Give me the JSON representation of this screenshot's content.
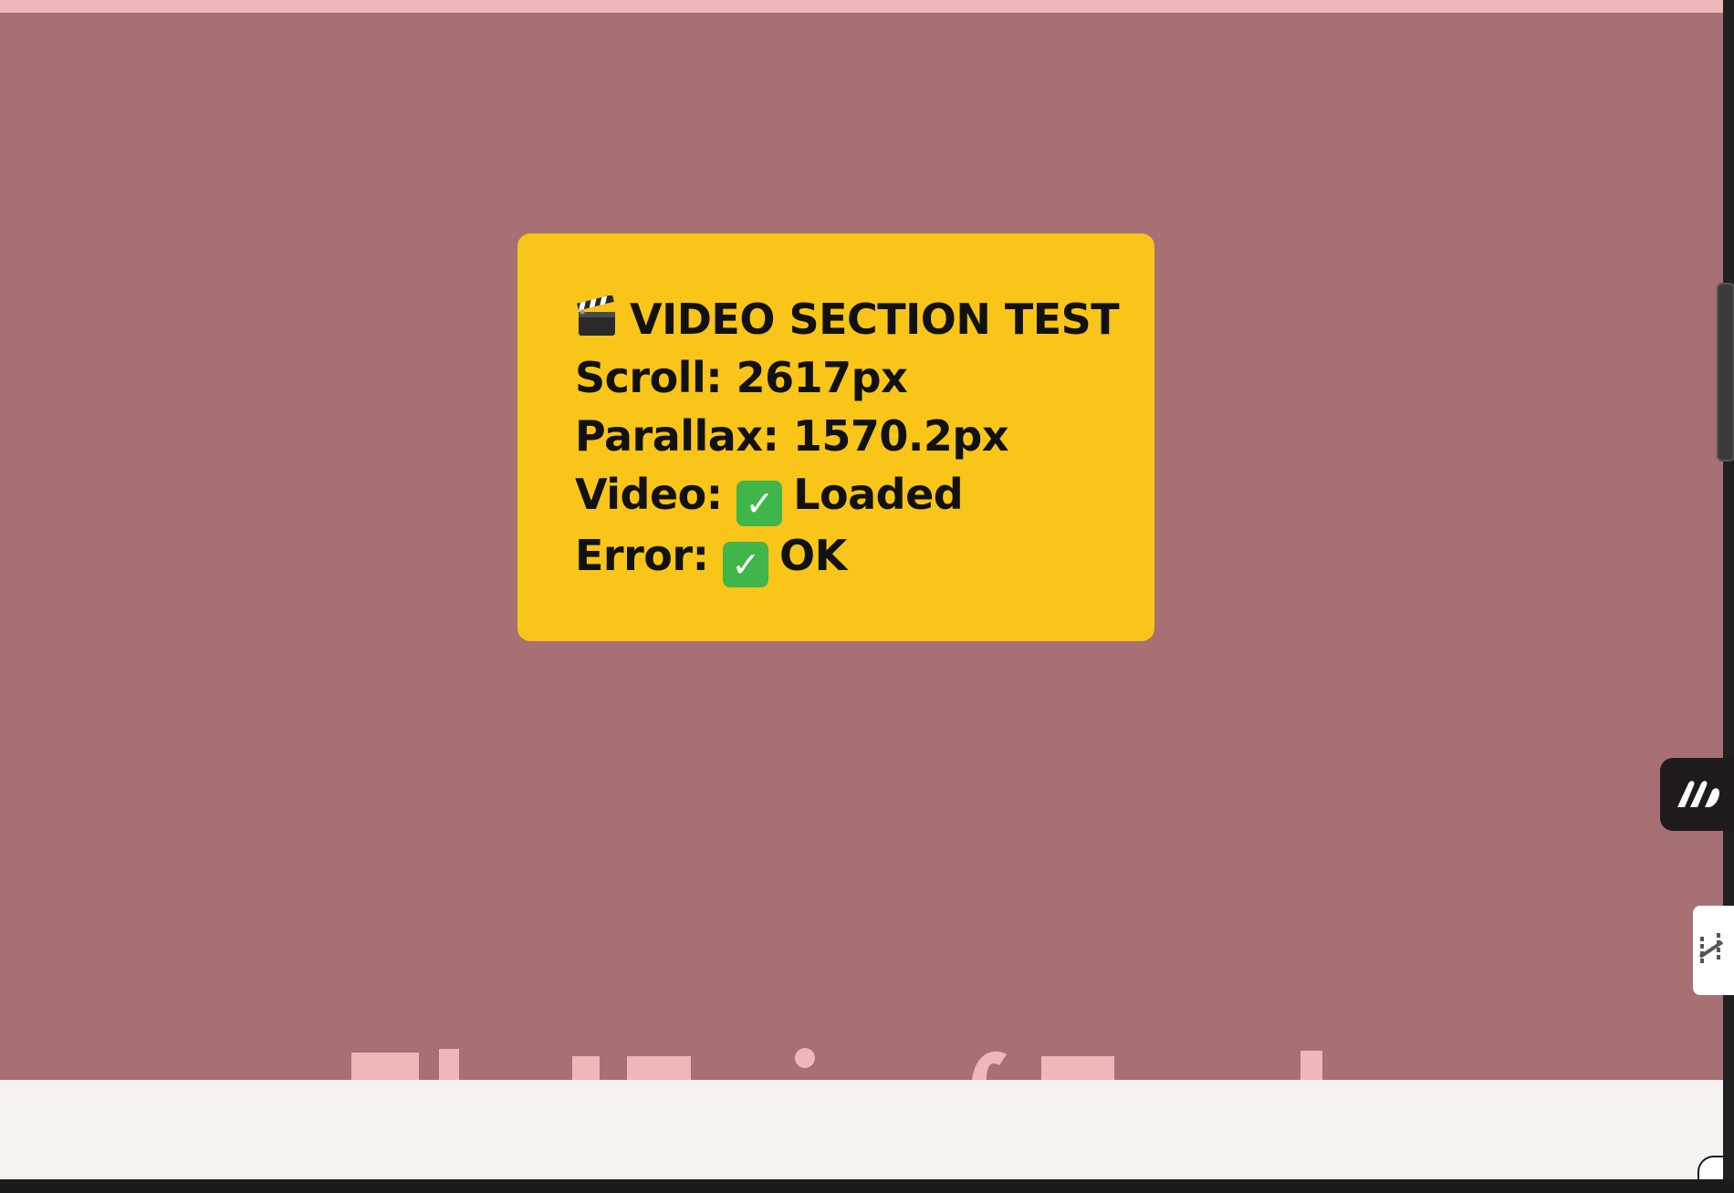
{
  "debug_panel": {
    "title": "VIDEO SECTION TEST",
    "title_icon": "clapperboard-icon",
    "scroll_label": "Scroll: 2617px",
    "parallax_label": "Parallax: 1570.2px",
    "video_prefix": "Video:",
    "video_status": "Loaded",
    "error_prefix": "Error:",
    "error_status": "OK",
    "status_icon": "check-mark-icon"
  },
  "colors": {
    "page_background": "#a67074",
    "top_strip": "#f0b7ba",
    "panel_background": "#f8c518",
    "headline": "#f0b7ba",
    "bottom_band": "#f4f1ee",
    "check_green": "#3fb54a"
  },
  "side_widgets": [
    {
      "name": "m-logo-widget",
      "icon": "m-logo-icon"
    },
    {
      "name": "h-logo-widget",
      "icon": "h-logo-icon"
    }
  ]
}
